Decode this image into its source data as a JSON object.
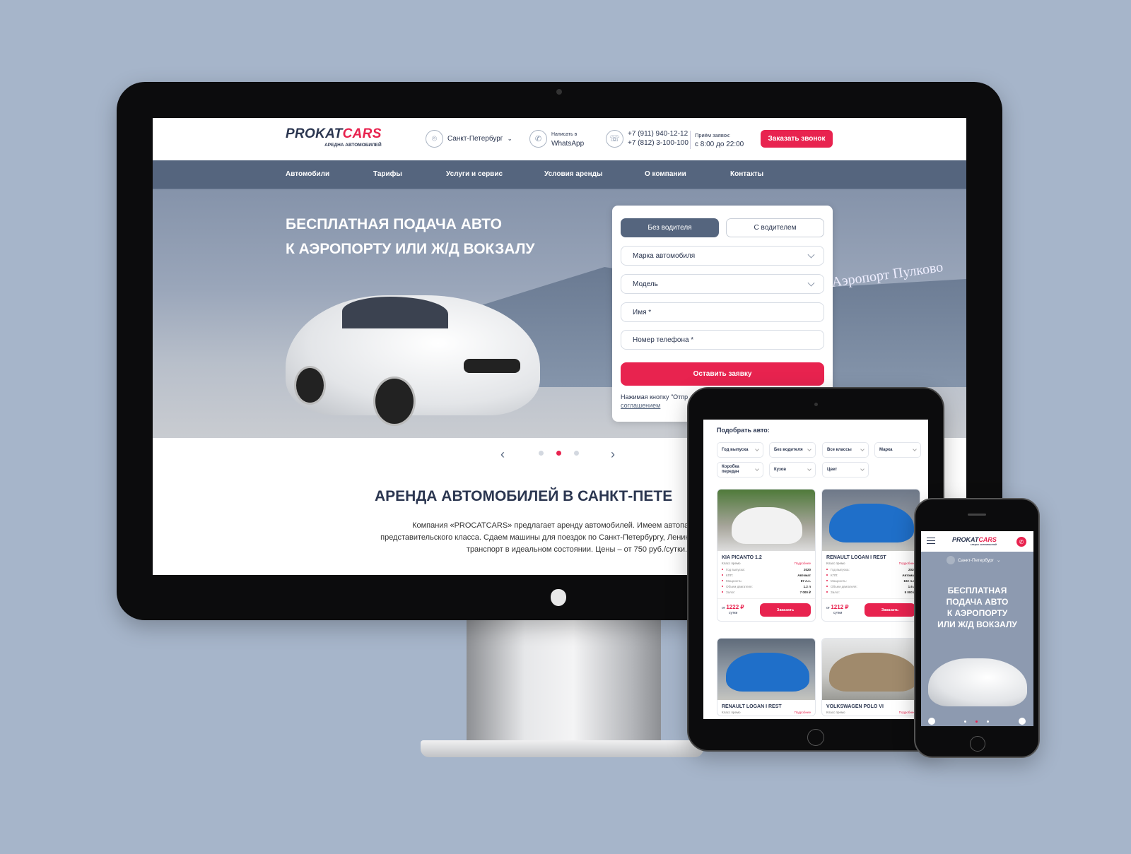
{
  "brand": {
    "name_a": "PROKAT",
    "name_b": "CARS",
    "tagline": "АРЕДНА АВТОМОБИЛЕЙ"
  },
  "colors": {
    "accent": "#e8234f",
    "nav": "#55657e",
    "text": "#2b3650",
    "background": "#a6b5ca"
  },
  "header": {
    "city": "Санкт-Петербург",
    "whatsapp_line1": "Написать в",
    "whatsapp_line2": "WhatsApp",
    "phone1": "+7 (911) 940-12-12",
    "phone2": "+7 (812) 3-100-100",
    "hours_label": "Приём заявок:",
    "hours": "с 8:00 до 22:00",
    "callback": "Заказать звонок"
  },
  "nav": [
    {
      "label": "Автомобили"
    },
    {
      "label": "Тарифы"
    },
    {
      "label": "Услуги и сервис"
    },
    {
      "label": "Условия аренды"
    },
    {
      "label": "О компании"
    },
    {
      "label": "Контакты"
    }
  ],
  "hero": {
    "line1": "БЕСПЛАТНАЯ ПОДАЧА АВТО",
    "line2": "К АЭРОПОРТУ ИЛИ Ж/Д ВОКЗАЛУ",
    "sign": "Аэропорт Пулково",
    "active_slide": 2,
    "slides": 3
  },
  "form": {
    "tab_active": "Без водителя",
    "tab_other": "С водителем",
    "brand_select": "Марка автомобиля",
    "model_select": "Модель",
    "name_placeholder": "Имя *",
    "phone_placeholder": "Номер телефона *",
    "submit": "Оставить заявку",
    "note": "Нажимая кнопку \"Отпр",
    "note_link": "соглашением"
  },
  "about": {
    "title": "АРЕНДА АВТОМОБИЛЕЙ В САНКТ-ПЕТЕ",
    "line1": "Компания «PROCATCARS» предлагает аренду автомобилей. Имеем автопарк с большим выбор",
    "line2": "представительского класса. Сдаем машины для поездок по Санкт-Петербургу, Ленинградской облас",
    "line3": "транспорт в идеальном состоянии.  Цены – от 750 руб./сутки."
  },
  "tablet": {
    "title": "Подобрать авто:",
    "filters": [
      "Год выпуска",
      "Без водителя",
      "Все классы",
      "Марка",
      "Коробка передач",
      "Кузов",
      "Цвет"
    ],
    "more": "Подробнее",
    "order": "Заказать",
    "from": "от",
    "per": "сутки",
    "spec_labels": [
      "Год выпуска:",
      "КПП:",
      "Мощность:",
      "Объем двигателя:",
      "Залог:"
    ],
    "cars": [
      {
        "name": "KIA PICANTO 1.2",
        "class": "Класс премо",
        "specs": [
          "2020",
          "Автомат",
          "87 л.с.",
          "1.2 л",
          "7 000 ₽"
        ],
        "price": "1222 ₽"
      },
      {
        "name": "RENAULT LOGAN I REST",
        "class": "Класс премо",
        "specs": [
          "2020",
          "Автомат",
          "102 л.с.",
          "1.6 л",
          "5 000 ₽"
        ],
        "price": "1212 ₽"
      },
      {
        "name": "RENAULT LOGAN I REST",
        "class": "Класс премо"
      },
      {
        "name": "VOLKSWAGEN POLO VI",
        "class": "Класс премо"
      }
    ]
  },
  "phone": {
    "city": "Санкт-Петербург",
    "line1": "БЕСПЛАТНАЯ",
    "line2": "ПОДАЧА АВТО",
    "line3": "К АЭРОПОРТУ",
    "line4": "ИЛИ Ж/Д ВОКЗАЛУ"
  }
}
